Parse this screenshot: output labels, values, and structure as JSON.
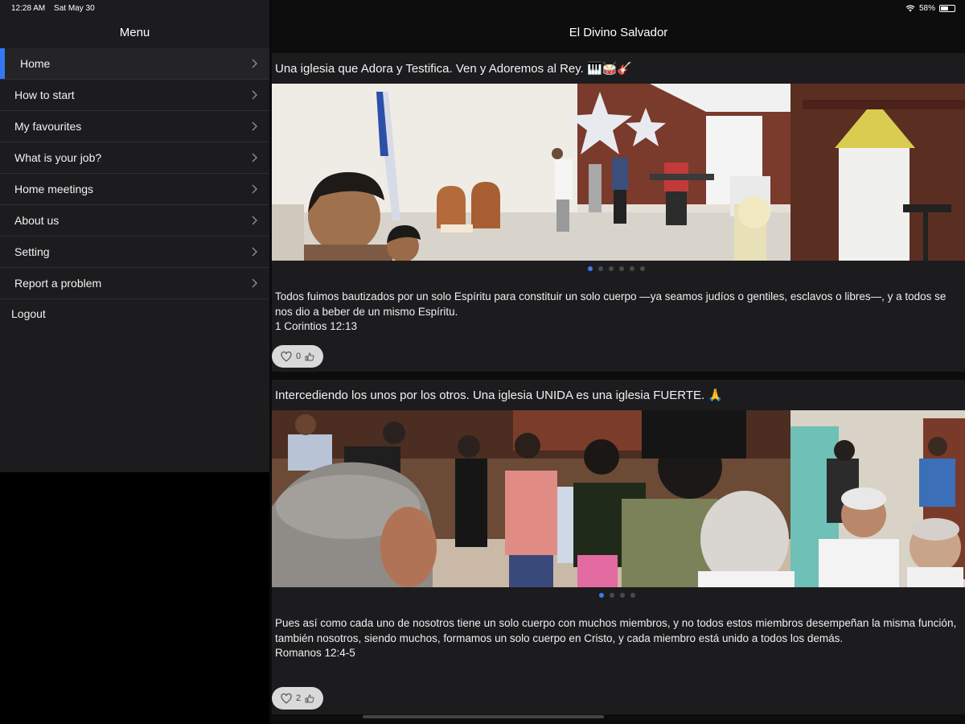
{
  "status": {
    "time": "12:28 AM",
    "date": "Sat May 30",
    "battery": "58%",
    "battery_level": 0.58
  },
  "sidebar": {
    "title": "Menu",
    "items": [
      {
        "label": "Home",
        "active": true
      },
      {
        "label": "How to start"
      },
      {
        "label": "My favourites"
      },
      {
        "label": "What is your job?"
      },
      {
        "label": "Home meetings"
      },
      {
        "label": "About us"
      },
      {
        "label": "Setting"
      },
      {
        "label": "Report a problem"
      }
    ],
    "logout": "Logout"
  },
  "main": {
    "title": "El Divino Salvador",
    "posts": [
      {
        "title": "Una iglesia que Adora y Testifica. Ven y Adoremos al Rey. 🎹🥁🎸",
        "body": "Todos fuimos bautizados por un solo Espíritu para constituir un solo cuerpo —ya seamos judíos o gentiles, esclavos o libres—, y a todos se nos dio a beber de un mismo Espíritu.",
        "reference": "1 Corintios 12:13",
        "likes": "0",
        "image_count": 6,
        "current_image": 1
      },
      {
        "title": "Intercediendo los unos por los otros. Una iglesia UNIDA es una iglesia FUERTE. 🙏",
        "body": "Pues así como cada uno de nosotros tiene un solo cuerpo con muchos miembros, y no todos estos miembros desempeñan la misma función, también nosotros, siendo muchos, formamos un solo cuerpo en Cristo, y cada miembro está unido a todos los demás.",
        "reference": "Romanos 12:4-5",
        "likes": "2",
        "image_count": 4,
        "current_image": 1
      }
    ]
  },
  "colors": {
    "accent": "#3478f6",
    "sidebar_bg": "#1c1c1e",
    "card_bg": "#1c1c1e",
    "page_bg": "#0d0d0d"
  }
}
